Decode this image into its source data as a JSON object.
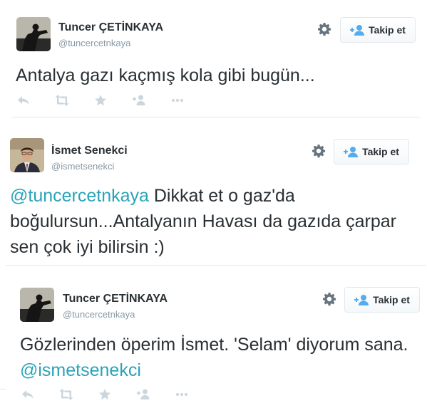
{
  "tweets": [
    {
      "fullname": "Tuncer ÇETİNKAYA",
      "username": "@tuncercetnkaya",
      "follow_label": "Takip et",
      "text_before": "Antalya gazı kaçmış kola gibi bugün...",
      "mention": "",
      "text_after": ""
    },
    {
      "fullname": "İsmet Senekci",
      "username": "@ismetsenekci",
      "follow_label": "Takip et",
      "mention": "@tuncercetnkaya",
      "text_after": " Dikkat et o gaz'da boğulursun...Antalyanın Havası da gazıda çarpar sen çok iyi bilirsin :)"
    },
    {
      "fullname": "Tuncer ÇETİNKAYA",
      "username": "@tuncercetnkaya",
      "follow_label": "Takip et",
      "text_before": "Gözlerinden öperim İsmet. 'Selam' diyorum sana. ",
      "mention": "@ismetsenekci"
    }
  ],
  "icons": {
    "settings": "gear-icon",
    "follow": "person-add-icon",
    "reply": "reply-icon",
    "retweet": "retweet-icon",
    "favorite": "star-icon",
    "follow_action": "follow-icon",
    "more": "more-icon"
  },
  "colors": {
    "mention": "#2aa3b9",
    "secondary_text": "#8899a6",
    "action_icon": "#ccd6dd",
    "follow_icon": "#55acee"
  }
}
